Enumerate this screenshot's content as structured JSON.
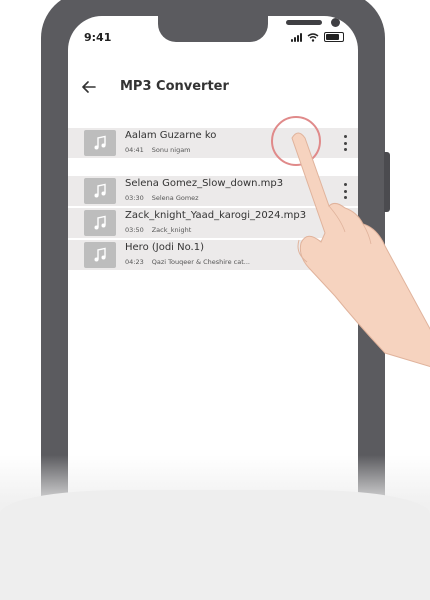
{
  "status_bar": {
    "time": "9:41"
  },
  "app_bar": {
    "title": "MP3 Converter"
  },
  "songs": [
    {
      "title": "Aalam Guzarne ko",
      "duration": "04:41",
      "artist": "Sonu nigam"
    },
    {
      "title": "Selena Gomez_Slow_down.mp3",
      "duration": "03:30",
      "artist": "Selena Gomez"
    },
    {
      "title": "Zack_knight_Yaad_karogi_2024.mp3",
      "duration": "03:50",
      "artist": "Zack_knight"
    },
    {
      "title": "Hero (Jodi No.1)",
      "duration": "04:23",
      "artist": "Qazi Touqeer & Cheshire cat..."
    }
  ],
  "colors": {
    "phone_frame": "#5b5b5f",
    "row_background": "#eceaea",
    "thumb_background": "#bdbdbd",
    "tap_ring": "#e08a8a",
    "hand": "#f6d3bf"
  },
  "icons": {
    "back": "arrow-left-icon",
    "thumb": "music-note-icon",
    "more": "more-vertical-icon"
  }
}
